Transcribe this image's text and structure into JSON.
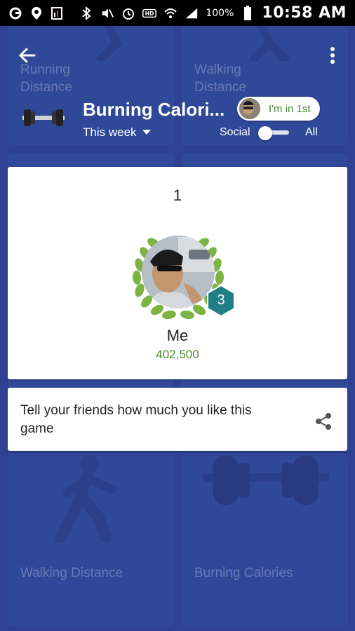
{
  "status_bar": {
    "battery": "100%",
    "time": "10:58 AM"
  },
  "header": {
    "title": "Burning Calori...",
    "period_selector": "This week",
    "rank_badge": "I'm in 1st",
    "toggle_left_label": "Social",
    "toggle_right_label": "All"
  },
  "background_tiles": {
    "top_left_label": "Running Distance",
    "top_right_label": "Walking Distance",
    "bottom_left_label": "Walking Distance",
    "bottom_right_label": "Burning Calories"
  },
  "leaderboard_card": {
    "rank": "1",
    "level": "3",
    "name": "Me",
    "score": "402,500"
  },
  "share_card": {
    "text": "Tell your friends how much you like this game"
  },
  "colors": {
    "background": "#2f4192",
    "score_green": "#4b8f2a",
    "level_badge": "#1f7f87",
    "laurel": "#7cb342"
  }
}
